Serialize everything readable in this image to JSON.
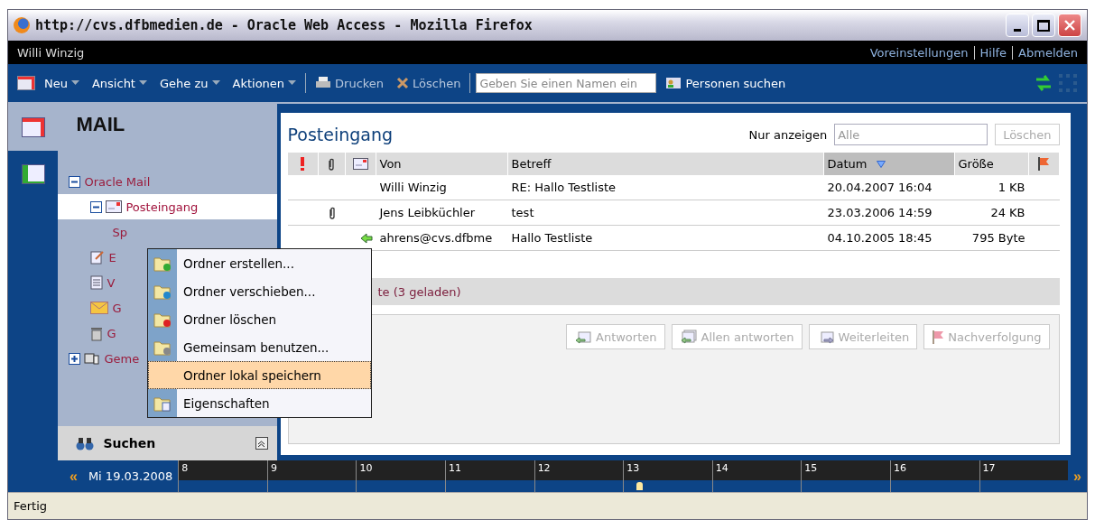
{
  "window": {
    "title": "http://cvs.dfbmedien.de - Oracle Web Access - Mozilla Firefox"
  },
  "user_bar": {
    "user": "Willi Winzig",
    "links": [
      "Voreinstellungen",
      "Hilfe",
      "Abmelden"
    ]
  },
  "toolbar": {
    "menus": [
      "Neu",
      "Ansicht",
      "Gehe zu",
      "Aktionen"
    ],
    "actions": [
      {
        "kind": "print",
        "label": "Drucken"
      },
      {
        "kind": "delete",
        "label": "Löschen"
      }
    ],
    "name_field": {
      "placeholder": "Geben Sie einen Namen ein"
    },
    "people_search": "Personen suchen"
  },
  "sidebar": {
    "title": "MAIL",
    "tree": [
      {
        "label": "Oracle Mail",
        "expanded": true,
        "selected": false,
        "children": [
          {
            "label": "Posteingang",
            "kind": "inbox",
            "expanded": true,
            "selected": true,
            "children": [
              {
                "label": "Sp",
                "selected": false
              }
            ]
          },
          {
            "label": "E",
            "kind": "drafts",
            "selected": false
          },
          {
            "label": "V",
            "kind": "sent",
            "selected": false
          },
          {
            "label": "G",
            "kind": "mail",
            "selected": false
          },
          {
            "label": "G",
            "kind": "trash",
            "selected": false
          }
        ]
      },
      {
        "label": "Geme",
        "kind": "shared",
        "expanded": false,
        "selected": false
      }
    ],
    "search": "Suchen"
  },
  "context_menu": [
    {
      "kind": "create",
      "label": "Ordner erstellen...",
      "selected": false
    },
    {
      "kind": "move",
      "label": "Ordner verschieben...",
      "selected": false
    },
    {
      "kind": "delete",
      "label": "Ordner löschen",
      "selected": false
    },
    {
      "kind": "share",
      "label": "Gemeinsam benutzen...",
      "selected": false
    },
    {
      "kind": "none",
      "label": "Ordner lokal speichern",
      "selected": true
    },
    {
      "kind": "props",
      "label": "Eigenschaften",
      "selected": false
    }
  ],
  "inbox": {
    "title": "Posteingang",
    "filter_label": "Nur anzeigen",
    "filter": {
      "value": "Alle"
    },
    "clear_button": "Löschen",
    "columns": [
      {
        "kind": "priority"
      },
      {
        "kind": "attachment"
      },
      {
        "kind": "type"
      },
      {
        "kind": "text",
        "label": "Von",
        "sorted": false
      },
      {
        "kind": "text",
        "label": "Betreff",
        "sorted": false
      },
      {
        "kind": "text",
        "label": "Datum",
        "sorted": true
      },
      {
        "kind": "text",
        "label": "Größe",
        "sorted": false
      },
      {
        "kind": "flag"
      }
    ],
    "rows": [
      {
        "attachment": false,
        "replied": false,
        "from": "Willi Winzig",
        "subject": "RE: Hallo Testliste",
        "date": "20.04.2007 16:04",
        "size": "1 KB"
      },
      {
        "attachment": true,
        "replied": false,
        "from": "Jens Leibküchler",
        "subject": "test",
        "date": "23.03.2006 14:59",
        "size": "24 KB"
      },
      {
        "attachment": false,
        "replied": true,
        "from": "ahrens@cvs.dfbme",
        "subject": "Hallo Testliste",
        "date": "04.10.2005 18:45",
        "size": "795 Byte"
      }
    ],
    "status": "te (3 geladen)",
    "buttons": [
      {
        "kind": "reply",
        "label": "Antworten",
        "disabled": true
      },
      {
        "kind": "reply_all",
        "label": "Allen antworten",
        "disabled": true
      },
      {
        "kind": "forward",
        "label": "Weiterleiten",
        "disabled": true
      },
      {
        "kind": "flag",
        "label": "Nachverfolgung",
        "disabled": true
      }
    ]
  },
  "timeline": {
    "prev": "«",
    "date": "Mi 19.03.2008",
    "hours": [
      "8",
      "9",
      "10",
      "11",
      "12",
      "13",
      "14",
      "15",
      "16",
      "17"
    ],
    "next": "»"
  },
  "status_bar": "Fertig"
}
